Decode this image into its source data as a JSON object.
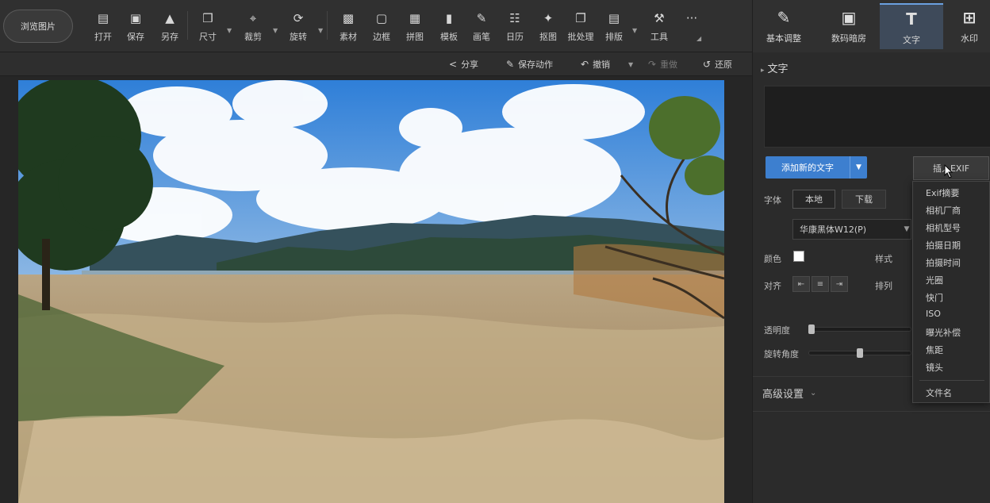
{
  "toolbar": {
    "browse_label": "浏览图片",
    "tools": [
      {
        "id": "open",
        "label": "打开"
      },
      {
        "id": "save",
        "label": "保存"
      },
      {
        "id": "save-as",
        "label": "另存"
      },
      {
        "id": "size",
        "label": "尺寸"
      },
      {
        "id": "crop",
        "label": "裁剪"
      },
      {
        "id": "rotate",
        "label": "旋转"
      },
      {
        "id": "material",
        "label": "素材"
      },
      {
        "id": "border",
        "label": "边框"
      },
      {
        "id": "puzzle",
        "label": "拼图"
      },
      {
        "id": "template",
        "label": "模板"
      },
      {
        "id": "brush",
        "label": "画笔"
      },
      {
        "id": "calendar",
        "label": "日历"
      },
      {
        "id": "pick",
        "label": "抠图"
      },
      {
        "id": "batch",
        "label": "批处理"
      },
      {
        "id": "layout",
        "label": "排版"
      },
      {
        "id": "tools",
        "label": "工具"
      }
    ],
    "more_label": "···"
  },
  "mode_tabs": [
    {
      "id": "basic",
      "label": "基本调整"
    },
    {
      "id": "darkroom",
      "label": "数码暗房"
    },
    {
      "id": "text",
      "label": "文字",
      "active": true
    },
    {
      "id": "watermark",
      "label": "水印"
    }
  ],
  "subbar": {
    "share": "分享",
    "save_action": "保存动作",
    "undo": "撤销",
    "redo": "重做",
    "restore": "还原"
  },
  "panel": {
    "title": "文字",
    "add_text": "添加新的文字",
    "insert_exif": "插入EXIF",
    "font_label": "字体",
    "local": "本地",
    "download": "下载",
    "font_value": "华康黑体W12(P)",
    "color_label": "颜色",
    "style_label": "样式",
    "align_label": "对齐",
    "arrange_label": "排列",
    "opacity_label": "透明度",
    "rotation_label": "旋转角度",
    "advanced": "高级设置",
    "text_color": "#ffffff",
    "opacity_value": 0,
    "rotation_value": 0.5
  },
  "exif_menu": {
    "items": [
      "Exif摘要",
      "相机厂商",
      "相机型号",
      "拍摄日期",
      "拍摄时间",
      "光圈",
      "快门",
      "ISO",
      "曝光补偿",
      "焦距",
      "镜头"
    ],
    "footer": "文件名"
  },
  "colors": {
    "accent": "#3d7fcf",
    "bg": "#2b2b2b",
    "toolbar": "#303030"
  }
}
